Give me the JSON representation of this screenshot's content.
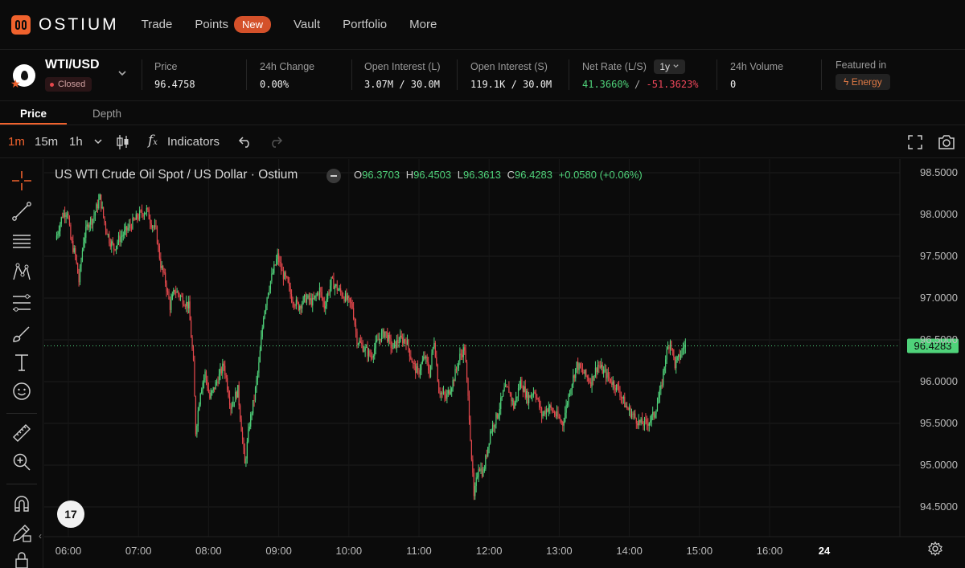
{
  "brand": {
    "name": "OSTIUM"
  },
  "nav": {
    "trade": "Trade",
    "points": "Points",
    "points_badge": "New",
    "vault": "Vault",
    "portfolio": "Portfolio",
    "more": "More"
  },
  "market": {
    "pair": "WTI/USD",
    "status": "Closed",
    "price_label": "Price",
    "price_value": "96.4758",
    "change_label": "24h Change",
    "change_value": "0.00%",
    "oi_long_label": "Open Interest (L)",
    "oi_long_value": "3.07M / 30.0M",
    "oi_short_label": "Open Interest (S)",
    "oi_short_value": "119.1K / 30.0M",
    "net_rate_label": "Net Rate (L/S)",
    "net_rate_period": "1y",
    "net_rate_long": "41.3660%",
    "net_rate_sep": "/",
    "net_rate_short": "-51.3623%",
    "volume_label": "24h Volume",
    "volume_value": "0",
    "featured_label": "Featured in",
    "featured_value": "Energy"
  },
  "tabs": {
    "price": "Price",
    "depth": "Depth"
  },
  "toolbar": {
    "tf_1m": "1m",
    "tf_15m": "15m",
    "tf_1h": "1h",
    "indicators": "Indicators"
  },
  "legend": {
    "title": "US WTI Crude Oil Spot / US Dollar · Ostium",
    "o_label": "O",
    "o": "96.3703",
    "h_label": "H",
    "h": "96.4503",
    "l_label": "L",
    "l": "96.3613",
    "c_label": "C",
    "c": "96.4283",
    "change": "+0.0580 (+0.06%)"
  },
  "colors": {
    "up": "#4fd27a",
    "down": "#e5484d",
    "accent": "#f0622d",
    "background": "#0b0b0b"
  },
  "chart_data": {
    "type": "candlestick",
    "ylim": [
      94.1,
      98.7
    ],
    "y_ticks": [
      "98.5000",
      "98.0000",
      "97.5000",
      "97.0000",
      "96.5000",
      "96.0000",
      "95.5000",
      "95.0000",
      "94.5000"
    ],
    "y_tick_values": [
      98.5,
      98.0,
      97.5,
      97.0,
      96.5,
      96.0,
      95.5,
      95.0,
      94.5
    ],
    "x_ticks": [
      "06:00",
      "07:00",
      "08:00",
      "09:00",
      "10:00",
      "11:00",
      "12:00",
      "13:00",
      "14:00",
      "15:00",
      "16:00",
      "24"
    ],
    "x_tick_minutes": [
      360,
      420,
      480,
      540,
      600,
      660,
      720,
      780,
      840,
      900,
      960,
      1440
    ],
    "current_price": 96.4283,
    "current_price_label": "96.4283",
    "x_range_minutes": [
      350,
      1110
    ],
    "path_anchors": [
      [
        350,
        97.7
      ],
      [
        356,
        98.0
      ],
      [
        360,
        98.05
      ],
      [
        363,
        97.7
      ],
      [
        367,
        97.5
      ],
      [
        370,
        97.2
      ],
      [
        374,
        97.7
      ],
      [
        378,
        97.9
      ],
      [
        382,
        97.95
      ],
      [
        388,
        98.2
      ],
      [
        392,
        97.9
      ],
      [
        396,
        97.7
      ],
      [
        400,
        97.6
      ],
      [
        404,
        97.7
      ],
      [
        410,
        97.8
      ],
      [
        416,
        97.9
      ],
      [
        422,
        98.0
      ],
      [
        428,
        98.05
      ],
      [
        432,
        97.9
      ],
      [
        436,
        97.8
      ],
      [
        440,
        97.4
      ],
      [
        444,
        97.2
      ],
      [
        448,
        96.9
      ],
      [
        452,
        97.1
      ],
      [
        458,
        97.0
      ],
      [
        464,
        96.9
      ],
      [
        468,
        96.2
      ],
      [
        470,
        95.4
      ],
      [
        474,
        95.9
      ],
      [
        478,
        96.1
      ],
      [
        482,
        95.8
      ],
      [
        488,
        96.0
      ],
      [
        494,
        96.2
      ],
      [
        500,
        95.7
      ],
      [
        506,
        95.9
      ],
      [
        510,
        95.3
      ],
      [
        512,
        95.0
      ],
      [
        516,
        95.5
      ],
      [
        520,
        95.8
      ],
      [
        524,
        96.2
      ],
      [
        528,
        96.8
      ],
      [
        532,
        97.1
      ],
      [
        536,
        97.3
      ],
      [
        540,
        97.5
      ],
      [
        544,
        97.3
      ],
      [
        548,
        97.2
      ],
      [
        552,
        97.0
      ],
      [
        558,
        96.9
      ],
      [
        564,
        97.0
      ],
      [
        570,
        96.95
      ],
      [
        576,
        97.1
      ],
      [
        580,
        96.9
      ],
      [
        586,
        97.2
      ],
      [
        592,
        97.1
      ],
      [
        598,
        97.0
      ],
      [
        604,
        96.9
      ],
      [
        608,
        96.5
      ],
      [
        614,
        96.4
      ],
      [
        620,
        96.3
      ],
      [
        626,
        96.5
      ],
      [
        632,
        96.6
      ],
      [
        638,
        96.4
      ],
      [
        644,
        96.5
      ],
      [
        650,
        96.5
      ],
      [
        656,
        96.2
      ],
      [
        660,
        96.1
      ],
      [
        666,
        96.3
      ],
      [
        670,
        96.1
      ],
      [
        674,
        96.5
      ],
      [
        678,
        95.9
      ],
      [
        684,
        95.8
      ],
      [
        690,
        96.0
      ],
      [
        696,
        96.3
      ],
      [
        700,
        96.4
      ],
      [
        704,
        95.6
      ],
      [
        708,
        94.6
      ],
      [
        712,
        95.0
      ],
      [
        716,
        94.9
      ],
      [
        722,
        95.4
      ],
      [
        728,
        95.6
      ],
      [
        734,
        95.9
      ],
      [
        738,
        95.9
      ],
      [
        742,
        95.7
      ],
      [
        748,
        96.0
      ],
      [
        754,
        95.8
      ],
      [
        760,
        95.9
      ],
      [
        766,
        95.6
      ],
      [
        772,
        95.7
      ],
      [
        778,
        95.6
      ],
      [
        784,
        95.5
      ],
      [
        790,
        95.9
      ],
      [
        796,
        96.2
      ],
      [
        802,
        96.1
      ],
      [
        808,
        96.0
      ],
      [
        814,
        96.2
      ],
      [
        820,
        96.1
      ],
      [
        826,
        96.0
      ],
      [
        832,
        95.9
      ],
      [
        838,
        95.7
      ],
      [
        844,
        95.6
      ],
      [
        850,
        95.5
      ],
      [
        856,
        95.5
      ],
      [
        862,
        95.6
      ],
      [
        868,
        95.9
      ],
      [
        872,
        96.3
      ],
      [
        876,
        96.5
      ],
      [
        880,
        96.2
      ],
      [
        884,
        96.3
      ],
      [
        888,
        96.43
      ]
    ]
  }
}
